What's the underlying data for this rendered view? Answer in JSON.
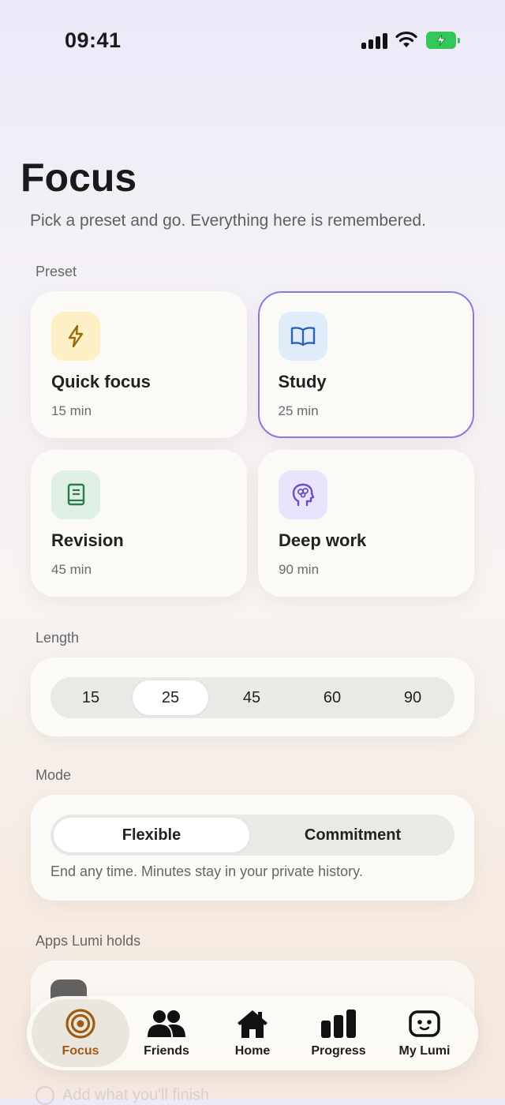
{
  "status_bar": {
    "time": "09:41"
  },
  "header": {
    "title": "Focus",
    "subtitle": "Pick a preset and go. Everything here is remembered."
  },
  "preset_section": {
    "label": "Preset",
    "items": [
      {
        "name": "Quick focus",
        "duration": "15 min",
        "icon": "lightning-icon",
        "selected": false
      },
      {
        "name": "Study",
        "duration": "25 min",
        "icon": "book-open-icon",
        "selected": true
      },
      {
        "name": "Revision",
        "duration": "45 min",
        "icon": "notebook-icon",
        "selected": false
      },
      {
        "name": "Deep work",
        "duration": "90 min",
        "icon": "brain-head-icon",
        "selected": false
      }
    ]
  },
  "length_section": {
    "label": "Length",
    "options": [
      "15",
      "25",
      "45",
      "60",
      "90"
    ],
    "selected": "25"
  },
  "mode_section": {
    "label": "Mode",
    "options": [
      "Flexible",
      "Commitment"
    ],
    "selected": "Flexible",
    "note": "End any time. Minutes stay in your private history."
  },
  "apps_section": {
    "label": "Apps Lumi holds"
  },
  "footer_hint": "Add what you'll finish",
  "tab_bar": {
    "items": [
      {
        "label": "Focus",
        "icon": "target-icon",
        "active": true
      },
      {
        "label": "Friends",
        "icon": "people-icon",
        "active": false
      },
      {
        "label": "Home",
        "icon": "house-icon",
        "active": false
      },
      {
        "label": "Progress",
        "icon": "bar-chart-icon",
        "active": false
      },
      {
        "label": "My Lumi",
        "icon": "lumi-face-icon",
        "active": false
      }
    ]
  },
  "colors": {
    "accent_purple": "#8b78e0",
    "focus_orange": "#a05a12",
    "battery_green": "#34c759"
  }
}
